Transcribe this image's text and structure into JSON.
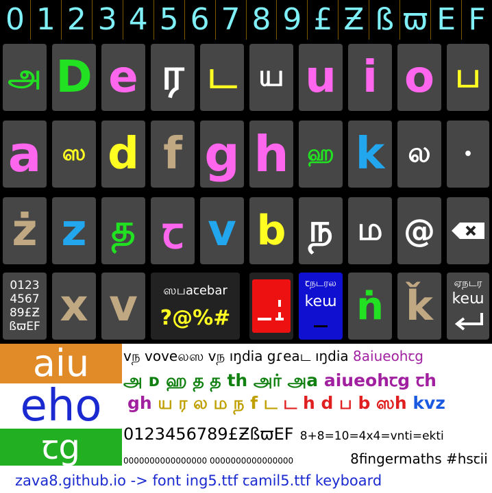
{
  "digit_row": [
    "0",
    "1",
    "2",
    "3",
    "4",
    "5",
    "6",
    "7",
    "8",
    "9",
    "£",
    "Ƶ",
    "ß",
    "ϖ",
    "E",
    "F"
  ],
  "keys": [
    {
      "label": "அ",
      "color": "#22e022",
      "row": 0,
      "col": 0,
      "size": 44
    },
    {
      "label": "D",
      "color": "#22e022",
      "row": 0,
      "col": 1,
      "size": 64
    },
    {
      "label": "e",
      "color": "#ff66ee",
      "row": 0,
      "col": 2,
      "size": 64
    },
    {
      "label": "ர",
      "color": "#ffffff",
      "row": 0,
      "col": 3,
      "size": 64
    },
    {
      "label": "ட",
      "color": "#ffff22",
      "row": 0,
      "col": 4,
      "size": 54
    },
    {
      "label": "ய",
      "color": "#ffffff",
      "row": 0,
      "col": 5,
      "size": 44
    },
    {
      "label": "u",
      "color": "#ff66ee",
      "row": 0,
      "col": 6,
      "size": 64
    },
    {
      "label": "i",
      "color": "#ff66ee",
      "row": 0,
      "col": 7,
      "size": 64
    },
    {
      "label": "o",
      "color": "#ff66ee",
      "row": 0,
      "col": 8,
      "size": 64
    },
    {
      "label": "ப",
      "color": "#ffff22",
      "row": 0,
      "col": 9,
      "size": 50
    },
    {
      "label": "a",
      "color": "#ff66ee",
      "row": 1,
      "col": 0,
      "size": 72
    },
    {
      "label": "ஸ",
      "color": "#ffff22",
      "row": 1,
      "col": 1,
      "size": 32
    },
    {
      "label": "d",
      "color": "#ffff22",
      "row": 1,
      "col": 2,
      "size": 64
    },
    {
      "label": "f",
      "color": "#c0a882",
      "row": 1,
      "col": 3,
      "size": 64
    },
    {
      "label": "g",
      "color": "#ff66ee",
      "row": 1,
      "col": 4,
      "size": 72
    },
    {
      "label": "h",
      "color": "#ff66ee",
      "row": 1,
      "col": 5,
      "size": 72
    },
    {
      "label": "ஹ",
      "color": "#22e022",
      "row": 1,
      "col": 6,
      "size": 32
    },
    {
      "label": "k",
      "color": "#22a6ee",
      "row": 1,
      "col": 7,
      "size": 64
    },
    {
      "label": "ல",
      "color": "#ffffff",
      "row": 1,
      "col": 8,
      "size": 40
    },
    {
      "label": "•",
      "color": "#ffffff",
      "row": 1,
      "col": 9,
      "size": 22
    },
    {
      "label": "ż",
      "color": "#c0a882",
      "row": 2,
      "col": 0,
      "size": 64
    },
    {
      "label": "z",
      "color": "#22a6ee",
      "row": 2,
      "col": 1,
      "size": 64
    },
    {
      "label": "த",
      "color": "#22e022",
      "row": 2,
      "col": 2,
      "size": 54
    },
    {
      "label": "ꞇ",
      "color": "#ff66ee",
      "row": 2,
      "col": 3,
      "size": 64
    },
    {
      "label": "v",
      "color": "#22a6ee",
      "row": 2,
      "col": 4,
      "size": 64
    },
    {
      "label": "b",
      "color": "#ffff22",
      "row": 2,
      "col": 5,
      "size": 60
    },
    {
      "label": "ந",
      "color": "#ffffff",
      "row": 2,
      "col": 6,
      "size": 56
    },
    {
      "label": "ம",
      "color": "#ffffff",
      "row": 2,
      "col": 7,
      "size": 46
    },
    {
      "label": "@",
      "color": "#ffffff",
      "row": 2,
      "col": 8,
      "size": 46
    },
    {
      "label": "x",
      "color": "#c0a882",
      "row": 3,
      "col": 1,
      "size": 64
    },
    {
      "label": "v",
      "color": "#c0a882",
      "row": 3,
      "col": 2,
      "size": 64
    },
    {
      "label": "ṅ",
      "color": "#22e022",
      "row": 3,
      "col": 7,
      "size": 56
    },
    {
      "label": "ǩ",
      "color": "#c0a882",
      "row": 3,
      "col": 8,
      "size": 60
    }
  ],
  "special_keys": {
    "hex_key": [
      "0123",
      "4567",
      "89£Ƶ",
      "ßϖEF"
    ],
    "spacebar_text": "ஸபaꞇebar",
    "spacebar_symbols": "?@%#",
    "blue_key_top": "ꞇநடரல",
    "blue_key_mid": "keɯ",
    "enter_key_top": "ஏநடர",
    "enter_key_mid": "keɯ"
  },
  "tiles": {
    "aiu": "aiu",
    "eho": "eho",
    "cg": "ꞇg"
  },
  "lines": {
    "line1_a": "vந voveலஸ vந ıŋdia gɾeaட ıŋdia",
    "line1_b": "8aiueohꞇg",
    "line2_a": "அ ᴅ ஹ த த",
    "line2_b": "th",
    "line2_c": "அர் அa",
    "line2_d": "aiueohꞇg ꞇh",
    "line3_a": "gh",
    "line3_b": "ய ர ல ம ந f ட",
    "line3_c": "ட",
    "line3_d": "h d ப b ஸh",
    "line3_e": "kvz",
    "line4_a": "0123456789£ƵßϖEF",
    "line4_b": "8+8=10=4x4=vnti=ekti",
    "line5_pattern": "0000000000000000 0000000000000000",
    "line5_text": "8fingermaths #hsꞇii",
    "footer_link": "zava8.github.io",
    "footer_rest": " -> font ing5.ttf ꞇamil5.ttf keyboard"
  },
  "colors": {
    "cyan": "#7ff0f8",
    "green": "#22e022",
    "pink": "#ff66ee",
    "yellow": "#ffff22",
    "tan": "#c0a882",
    "blue": "#22a6ee",
    "key_bg": "#464646",
    "orange_tile": "#e08a28",
    "green_tile": "#22b022",
    "blue_text": "#1a2ad0",
    "purple_text": "#a020a0",
    "olive_text": "#c0a000",
    "red_text": "#e02020",
    "dark_green_text": "#108010"
  }
}
